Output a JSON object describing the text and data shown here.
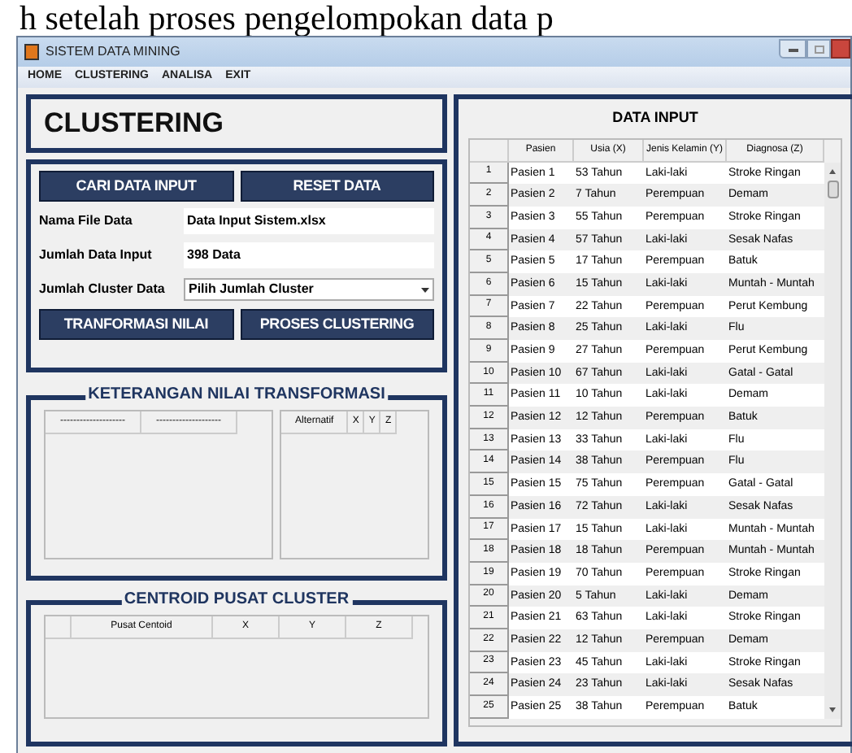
{
  "caption": "h setelah proses pengelompokan data p",
  "window": {
    "title": "SISTEM DATA MINING"
  },
  "menu": [
    "HOME",
    "CLUSTERING",
    "ANALISA",
    "EXIT"
  ],
  "left": {
    "heading": "CLUSTERING",
    "top_buttons": [
      "CARI DATA INPUT",
      "RESET DATA"
    ],
    "fields": [
      {
        "label": "Nama File  Data",
        "value": "Data Input Sistem.xlsx"
      },
      {
        "label": "Jumlah Data Input",
        "value": "398 Data"
      }
    ],
    "dropdown": {
      "label": "Jumlah Cluster Data",
      "value": "Pilih Jumlah Cluster"
    },
    "bottom_buttons": [
      "TRANFORMASI NILAI",
      "PROSES CLUSTERING"
    ],
    "transform": {
      "title": "KETERANGAN NILAI TRANSFORMASI",
      "table1_columns": [
        "--------------------",
        "--------------------"
      ],
      "table2_columns": [
        "Alternatif",
        "X",
        "Y",
        "Z"
      ]
    },
    "centroid": {
      "title": "CENTROID PUSAT CLUSTER",
      "columns": [
        "Pusat Centoid",
        "X",
        "Y",
        "Z"
      ]
    }
  },
  "data_input": {
    "title": "DATA INPUT",
    "columns": [
      "",
      "Pasien",
      "Usia (X)",
      "Jenis Kelamin (Y)",
      "Diagnosa (Z)"
    ],
    "rows": [
      [
        "1",
        "Pasien 1",
        "53 Tahun",
        "Laki-laki",
        "Stroke Ringan"
      ],
      [
        "2",
        "Pasien 2",
        "7 Tahun",
        "Perempuan",
        "Demam"
      ],
      [
        "3",
        "Pasien 3",
        "55 Tahun",
        "Perempuan",
        "Stroke Ringan"
      ],
      [
        "4",
        "Pasien 4",
        "57 Tahun",
        "Laki-laki",
        "Sesak Nafas"
      ],
      [
        "5",
        "Pasien 5",
        "17 Tahun",
        "Perempuan",
        "Batuk"
      ],
      [
        "6",
        "Pasien 6",
        "15 Tahun",
        "Laki-laki",
        "Muntah - Muntah"
      ],
      [
        "7",
        "Pasien 7",
        "22 Tahun",
        "Perempuan",
        "Perut Kembung"
      ],
      [
        "8",
        "Pasien 8",
        "25 Tahun",
        "Laki-laki",
        "Flu"
      ],
      [
        "9",
        "Pasien 9",
        "27 Tahun",
        "Perempuan",
        "Perut Kembung"
      ],
      [
        "10",
        "Pasien 10",
        "67 Tahun",
        "Laki-laki",
        "Gatal - Gatal"
      ],
      [
        "11",
        "Pasien 11",
        "10 Tahun",
        "Laki-laki",
        "Demam"
      ],
      [
        "12",
        "Pasien 12",
        "12 Tahun",
        "Perempuan",
        "Batuk"
      ],
      [
        "13",
        "Pasien 13",
        "33 Tahun",
        "Laki-laki",
        "Flu"
      ],
      [
        "14",
        "Pasien 14",
        "38 Tahun",
        "Perempuan",
        "Flu"
      ],
      [
        "15",
        "Pasien 15",
        "75 Tahun",
        "Perempuan",
        "Gatal - Gatal"
      ],
      [
        "16",
        "Pasien 16",
        "72 Tahun",
        "Laki-laki",
        "Sesak Nafas"
      ],
      [
        "17",
        "Pasien 17",
        "15 Tahun",
        "Laki-laki",
        "Muntah - Muntah"
      ],
      [
        "18",
        "Pasien 18",
        "18 Tahun",
        "Perempuan",
        "Muntah - Muntah"
      ],
      [
        "19",
        "Pasien 19",
        "70 Tahun",
        "Perempuan",
        "Stroke Ringan"
      ],
      [
        "20",
        "Pasien 20",
        "5 Tahun",
        "Laki-laki",
        "Demam"
      ],
      [
        "21",
        "Pasien 21",
        "63 Tahun",
        "Laki-laki",
        "Stroke Ringan"
      ],
      [
        "22",
        "Pasien 22",
        "12 Tahun",
        "Perempuan",
        "Demam"
      ],
      [
        "23",
        "Pasien 23",
        "45 Tahun",
        "Laki-laki",
        "Stroke Ringan"
      ],
      [
        "24",
        "Pasien 24",
        "23 Tahun",
        "Laki-laki",
        "Sesak Nafas"
      ],
      [
        "25",
        "Pasien 25",
        "38 Tahun",
        "Perempuan",
        "Batuk"
      ]
    ]
  }
}
